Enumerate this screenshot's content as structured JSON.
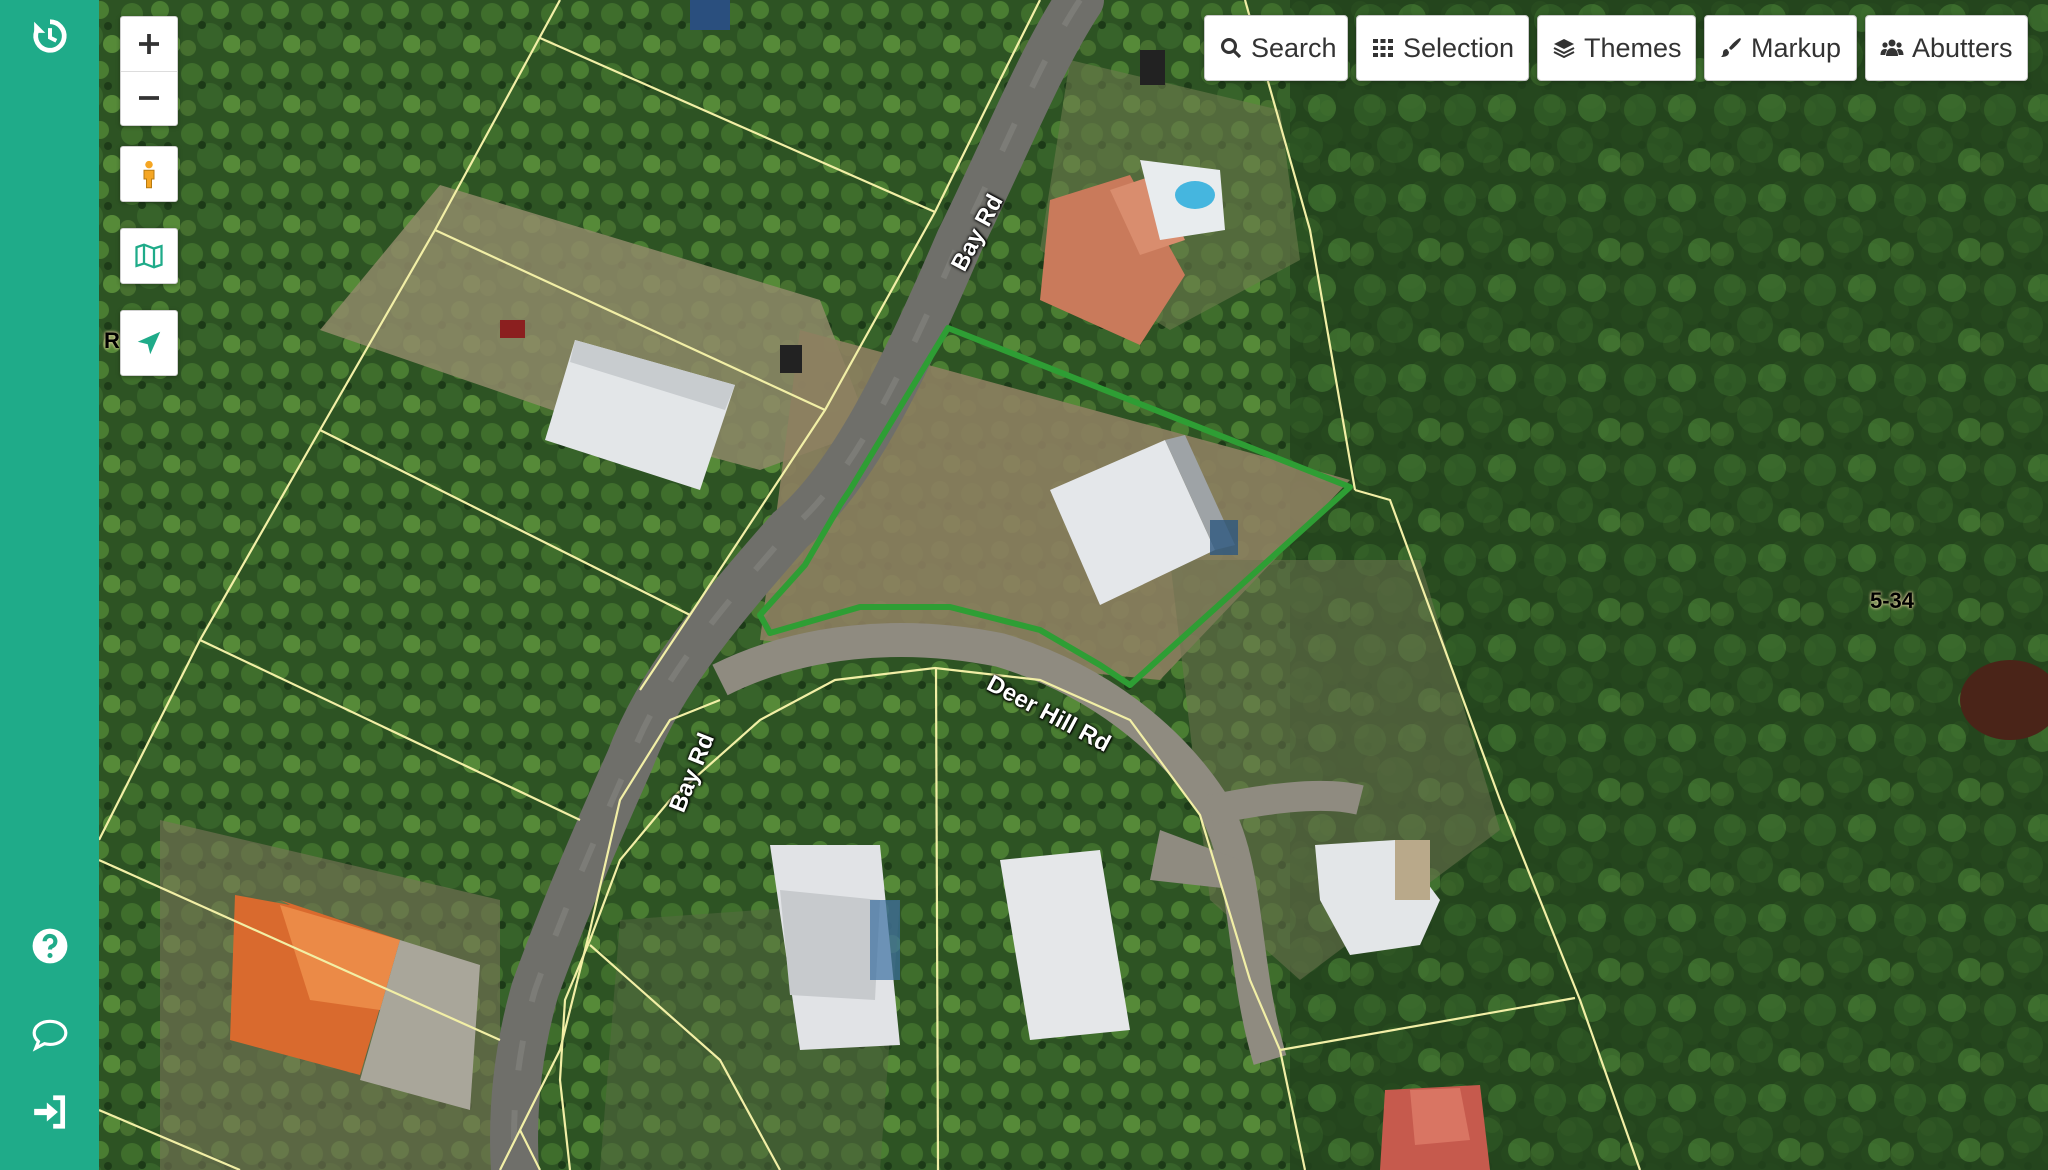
{
  "toolbar": {
    "search_label": "Search",
    "selection_label": "Selection",
    "themes_label": "Themes",
    "markup_label": "Markup",
    "abutters_label": "Abutters"
  },
  "map": {
    "road_labels": {
      "bay_rd_upper": "Bay Rd",
      "bay_rd_lower": "Bay Rd",
      "deer_hill_rd": "Deer Hill Rd"
    },
    "parcel_labels": {
      "parcel_5_34": "5-34",
      "edge_partial": "R"
    }
  },
  "colors": {
    "sidebar": "#1fab89",
    "selected_parcel": "#2e9e34",
    "parcel_lines": "#f2efa6"
  }
}
